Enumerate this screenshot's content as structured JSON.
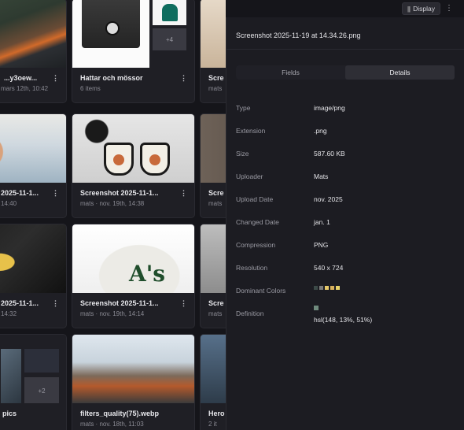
{
  "toolbar": {
    "display_label": "Display",
    "display_icon": "columns-icon",
    "more_icon": "more-vertical-icon"
  },
  "cards": [
    {
      "title": "...y3oew...",
      "meta": "mars 12th, 10:42"
    },
    {
      "title": "Hattar och mössor",
      "meta": "6 items",
      "extra_count": "+4"
    },
    {
      "title": "Scre",
      "meta": "mats"
    },
    {
      "title": "2025-11-1...",
      "meta": "14:40"
    },
    {
      "title": "Screenshot 2025-11-1...",
      "meta": "mats · nov. 19th, 14:38"
    },
    {
      "title": "Scre",
      "meta": "mats"
    },
    {
      "title": "2025-11-1...",
      "meta": "14:32"
    },
    {
      "title": "Screenshot 2025-11-1...",
      "meta": "mats · nov. 19th, 14:14"
    },
    {
      "title": "Scre",
      "meta": "mats"
    },
    {
      "title": "pics",
      "meta": "",
      "extra_count": "+2"
    },
    {
      "title": "filters_quality(75).webp",
      "meta": "mats · nov. 18th, 11:03"
    },
    {
      "title": "Hero",
      "meta": "2 it"
    }
  ],
  "panel": {
    "title": "Screenshot 2025-11-19 at 14.34.26.png",
    "tabs": [
      "Fields",
      "Details"
    ],
    "active_tab": "Details",
    "properties": [
      {
        "label": "Type",
        "value": "image/png"
      },
      {
        "label": "Extension",
        "value": ".png"
      },
      {
        "label": "Size",
        "value": "587.60 KB"
      },
      {
        "label": "Uploader",
        "value": "Mats"
      },
      {
        "label": "Upload Date",
        "value": "nov. 2025"
      },
      {
        "label": "Changed Date",
        "value": "jan. 1"
      },
      {
        "label": "Compression",
        "value": "PNG"
      },
      {
        "label": "Resolution",
        "value": "540 x 724"
      },
      {
        "label": "Dominant Colors",
        "value": ""
      },
      {
        "label": "Definition",
        "value": "hsl(148, 13%, 51%)"
      }
    ],
    "dominant_colors": [
      "#3c4a48",
      "#7a7a7a",
      "#e6c96a",
      "#d9b15c",
      "#e8d36a"
    ],
    "definition_color": "#6f8a7d"
  }
}
